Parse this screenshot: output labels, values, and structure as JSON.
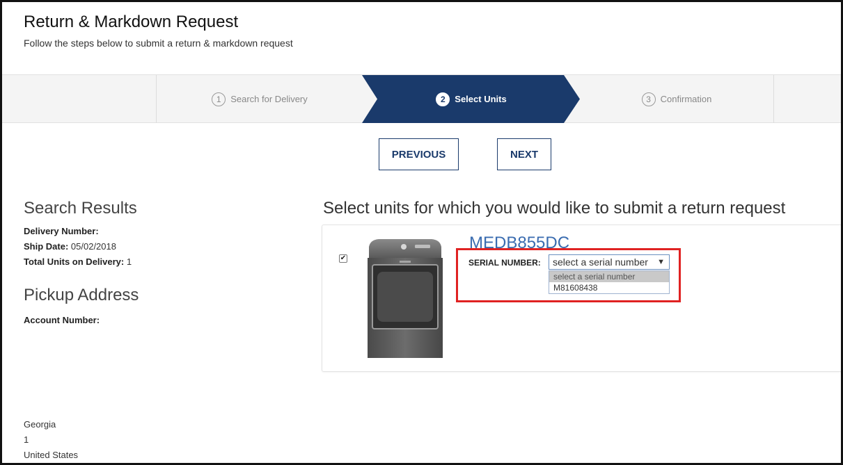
{
  "header": {
    "title": "Return & Markdown Request",
    "subtitle": "Follow the steps below to submit a return & markdown request"
  },
  "stepper": {
    "steps": [
      {
        "num": "1",
        "label": "Search for Delivery",
        "state": "inactive"
      },
      {
        "num": "2",
        "label": "Select Units",
        "state": "active"
      },
      {
        "num": "3",
        "label": "Confirmation",
        "state": "inactive"
      }
    ],
    "active_color": "#1a3a6b"
  },
  "nav": {
    "previous_label": "PREVIOUS",
    "next_label": "NEXT"
  },
  "search_results": {
    "heading": "Search Results",
    "delivery_number_label": "Delivery Number:",
    "delivery_number_value": "",
    "ship_date_label": "Ship Date:",
    "ship_date_value": " 05/02/2018",
    "total_units_label": "Total Units on Delivery:",
    "total_units_value": " 1"
  },
  "pickup": {
    "heading": "Pickup Address",
    "account_number_label": "Account Number:",
    "address_lines": [
      "Georgia",
      "1",
      "United States"
    ]
  },
  "units": {
    "instructions": "Select units for which you would like to submit a return request",
    "items": [
      {
        "model": "MEDB855DC",
        "checked": true,
        "checkmark": "✔",
        "image_icon": "dryer-appliance-image",
        "serial_label": "SERIAL NUMBER:",
        "serial_select_value": "select a serial number",
        "serial_options": [
          "select a serial number",
          "M81608438"
        ]
      }
    ]
  },
  "colors": {
    "brand_blue": "#1a3a6b",
    "link_blue": "#3a6cb0",
    "highlight_red": "#e02222"
  }
}
